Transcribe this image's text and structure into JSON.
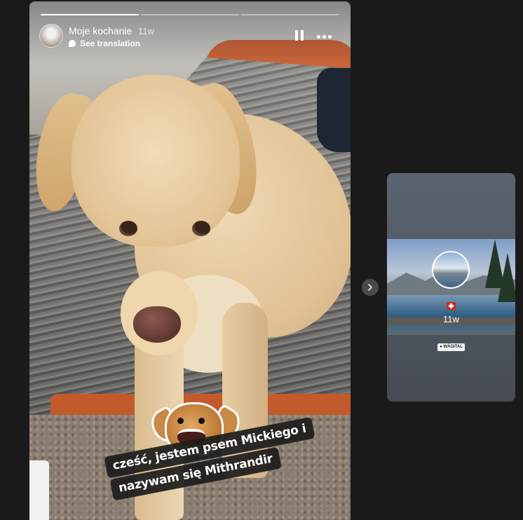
{
  "story": {
    "username": "Moje kochanie",
    "time": "11w",
    "see_translation": "See translation",
    "progress": [
      1.0,
      0.0,
      0.0
    ],
    "caption_lines": [
      "cześć, jestem psem Mickiego i",
      "nazywam się Mithrandir"
    ],
    "icons": {
      "pause": "pause-icon",
      "more": "more-options-icon",
      "translate": "speech-bubble-icon"
    }
  },
  "next_story": {
    "time": "11w",
    "location_tag": "● WÄGITAL",
    "flag": "swiss-flag-icon"
  },
  "navigation": {
    "next_icon": "chevron-right-icon"
  },
  "colors": {
    "background": "#1a1a1a",
    "text": "#ffffff"
  }
}
